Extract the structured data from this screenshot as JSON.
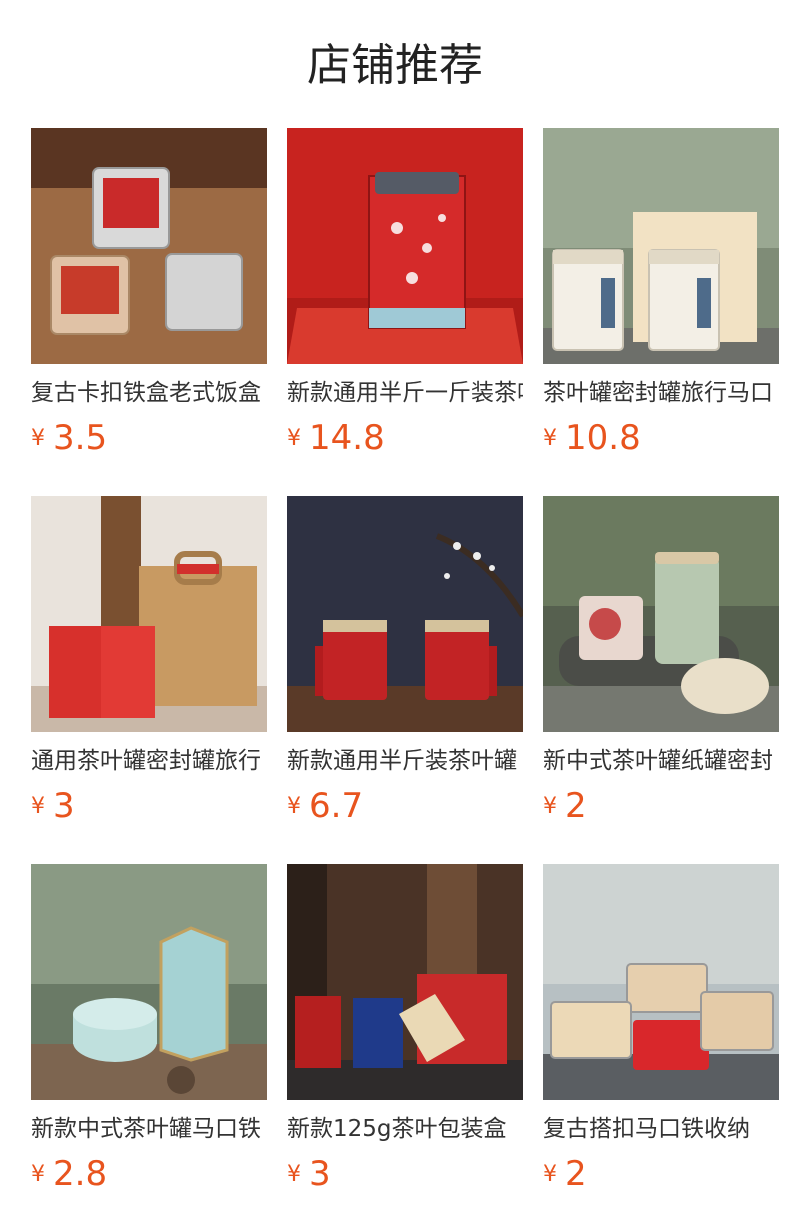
{
  "page": {
    "title": "店铺推荐"
  },
  "products": [
    {
      "name": "复古卡扣铁盒老式饭盒",
      "currency": "¥",
      "price": "3.5",
      "image_theme": "tin-box-on-wood",
      "image_text": ""
    },
    {
      "name": "新款通用半斤一斤装茶叶罐",
      "currency": "¥",
      "price": "14.8",
      "image_theme": "red-floral-can",
      "image_text": ""
    },
    {
      "name": "茶叶罐密封罐旅行马口",
      "currency": "¥",
      "price": "10.8",
      "image_theme": "white-tea-cans-bag",
      "image_text": ""
    },
    {
      "name": "通用茶叶罐密封罐旅行",
      "currency": "¥",
      "price": "3",
      "image_theme": "red-cans-kraft-bag",
      "image_text": ""
    },
    {
      "name": "新款通用半斤装茶叶罐",
      "currency": "¥",
      "price": "6.7",
      "image_theme": "red-tassel-cans",
      "image_text": ""
    },
    {
      "name": "新中式茶叶罐纸罐密封",
      "currency": "¥",
      "price": "2",
      "image_theme": "floral-paper-cans",
      "image_text": ""
    },
    {
      "name": "新款中式茶叶罐马口铁",
      "currency": "¥",
      "price": "2.8",
      "image_theme": "hexagon-teal-cans",
      "image_text": ""
    },
    {
      "name": "新款125g茶叶包装盒",
      "currency": "¥",
      "price": "3",
      "image_theme": "calligraphy-boxes",
      "image_text": ""
    },
    {
      "name": "复古搭扣马口铁收纳",
      "currency": "¥",
      "price": "2",
      "image_theme": "clasp-tin-boxes",
      "image_text": ""
    }
  ],
  "colors": {
    "price": "#e8541e",
    "text": "#333333",
    "background": "#ffffff"
  }
}
